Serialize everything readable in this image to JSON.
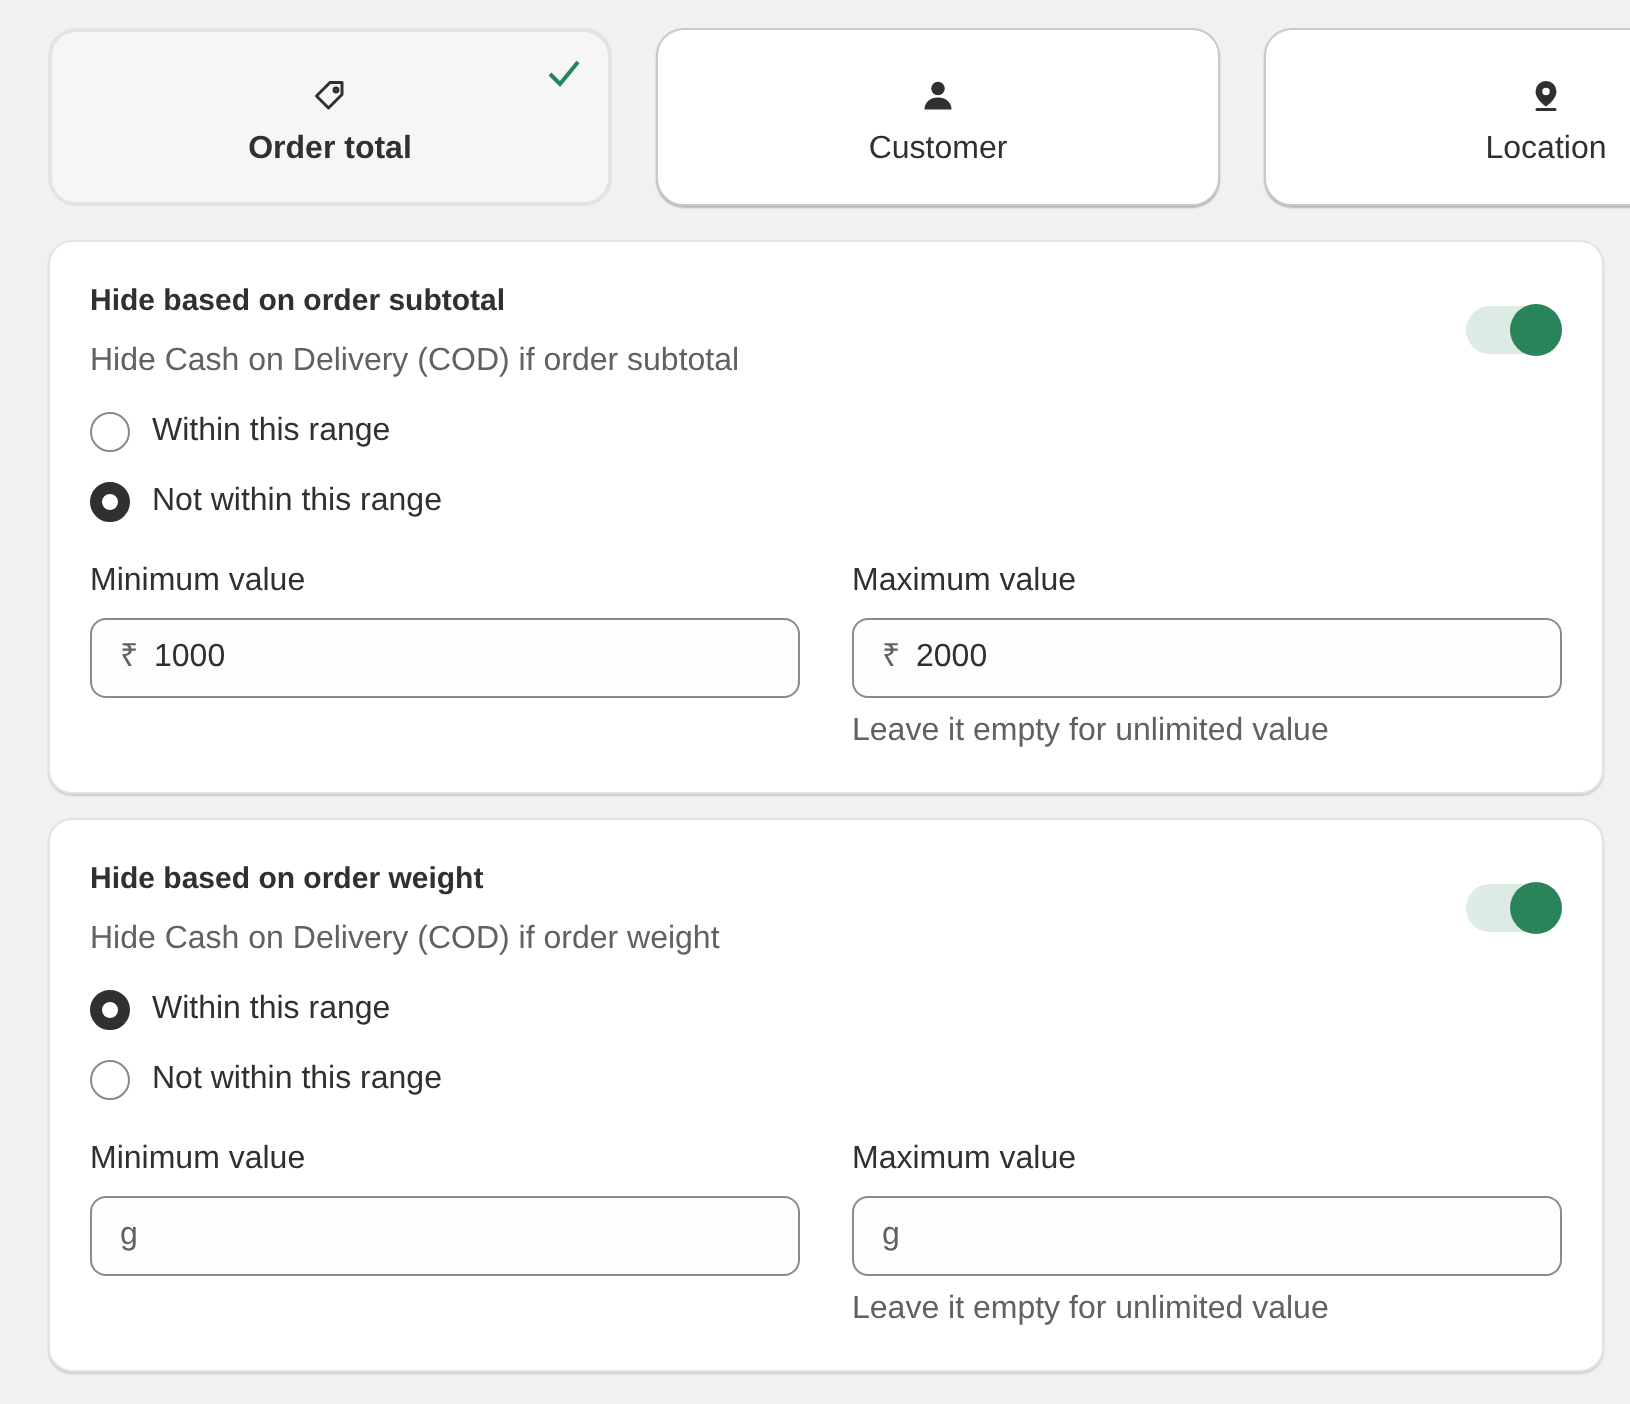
{
  "tabs": [
    {
      "label": "Order total",
      "kind": "tag",
      "selected": true
    },
    {
      "label": "Customer",
      "kind": "person",
      "selected": false
    },
    {
      "label": "Location",
      "kind": "pin",
      "selected": false
    }
  ],
  "sections": [
    {
      "title": "Hide based on order subtotal",
      "description": "Hide Cash on Delivery (COD) if order subtotal",
      "on": true,
      "options": [
        {
          "label": "Within this range",
          "selected": false
        },
        {
          "label": "Not within this range",
          "selected": true
        }
      ],
      "fields": [
        {
          "label": "Minimum value",
          "prefix": "₹",
          "value": "1000"
        },
        {
          "label": "Maximum value",
          "prefix": "₹",
          "value": "2000",
          "help": "Leave it empty for unlimited value"
        }
      ]
    },
    {
      "title": "Hide based on order weight",
      "description": "Hide Cash on Delivery (COD) if order weight",
      "on": true,
      "options": [
        {
          "label": "Within this range",
          "selected": true
        },
        {
          "label": "Not within this range",
          "selected": false
        }
      ],
      "fields": [
        {
          "label": "Minimum value",
          "prefix": "g"
        },
        {
          "label": "Maximum value",
          "prefix": "g",
          "help": "Leave it empty for unlimited value"
        }
      ]
    }
  ]
}
